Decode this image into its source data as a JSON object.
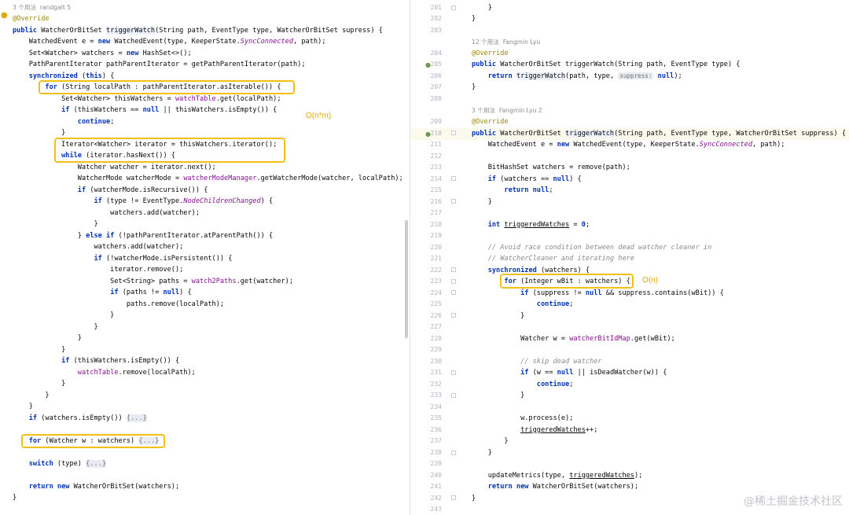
{
  "left": {
    "usage_hint": "3 个用法",
    "author_hint": "randgalt 5",
    "annotation": "@Override",
    "complexity_label": "O(n*m)"
  },
  "right": {
    "line_numbers": [
      "201",
      "202",
      "203",
      "",
      "204",
      "205",
      "206",
      "207",
      "208",
      "",
      "209",
      "210",
      "211",
      "212",
      "213",
      "214",
      "215",
      "216",
      "217",
      "218",
      "219",
      "220",
      "221",
      "222",
      "223",
      "224",
      "225",
      "226",
      "227",
      "228",
      "229",
      "230",
      "231",
      "232",
      "233",
      "234",
      "235",
      "236",
      "237",
      "238",
      "239",
      "240",
      "241",
      "242",
      "243"
    ],
    "usage_hint_1": "12 个用法",
    "author_hint_1": "Fangmin Lyu",
    "usage_hint_2": "3 个用法",
    "author_hint_2": "Fangmin Lyu 2",
    "annotation": "@Override",
    "param_hint": "suppress:",
    "complexity_label": "O(n)"
  },
  "watermark": "@稀土掘金技术社区",
  "colors": {
    "highlight_box": "#f5c016",
    "keyword": "#0033b3",
    "annotation": "#9e880d",
    "field": "#871094"
  }
}
